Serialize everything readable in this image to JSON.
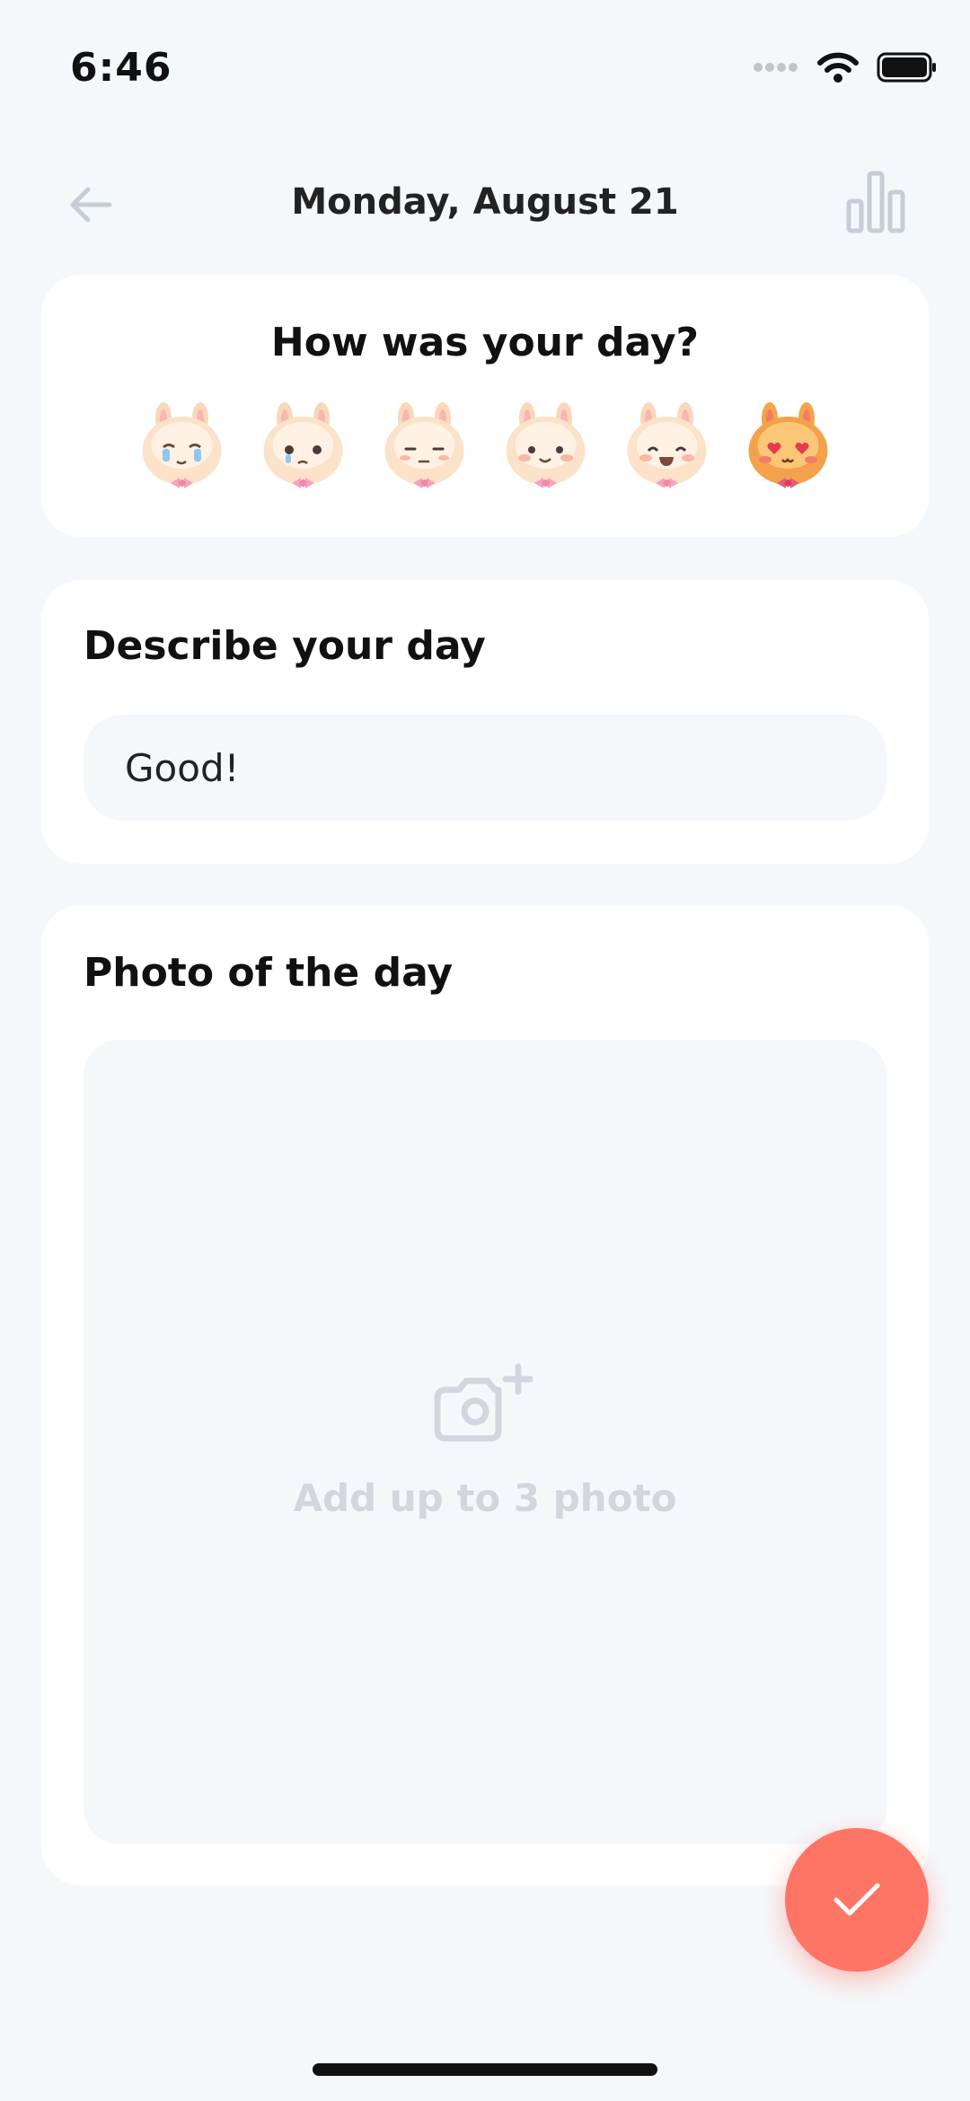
{
  "status_bar": {
    "time": "6:46",
    "icons": [
      "signal-icon",
      "wifi-icon",
      "battery-icon"
    ]
  },
  "header": {
    "title": "Monday, August 21",
    "back_icon": "arrow-left-icon",
    "stats_icon": "bar-chart-icon"
  },
  "mood": {
    "question": "How was your day?",
    "options": [
      {
        "name": "crying-bunny-icon",
        "selected": false
      },
      {
        "name": "sad-bunny-icon",
        "selected": false
      },
      {
        "name": "meh-bunny-icon",
        "selected": false
      },
      {
        "name": "content-bunny-icon",
        "selected": false
      },
      {
        "name": "happy-bunny-icon",
        "selected": false
      },
      {
        "name": "love-bunny-icon",
        "selected": true
      }
    ]
  },
  "describe": {
    "heading": "Describe your day",
    "value": "Good!"
  },
  "photo": {
    "heading": "Photo of the day",
    "hint": "Add up to 3 photo",
    "icon": "camera-add-icon"
  },
  "fab": {
    "icon": "checkmark-icon"
  },
  "colors": {
    "background": "#f5f8fb",
    "card": "#ffffff",
    "accent": "#ff7565",
    "muted_icon": "#d3d6df"
  }
}
